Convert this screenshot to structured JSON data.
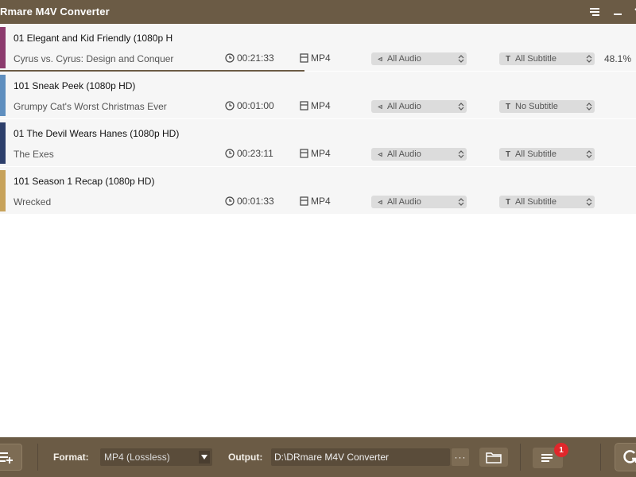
{
  "window": {
    "title": "Rmare M4V Converter"
  },
  "colors": {
    "chrome": "#6b5b45",
    "progress": "#6b5b45",
    "badge": "#e0272b"
  },
  "items": [
    {
      "title": "01 Elegant and Kid Friendly (1080p H",
      "show": "Cyrus vs. Cyrus: Design and Conquer",
      "duration": "00:21:33",
      "format": "MP4",
      "audio": "All Audio",
      "subtitle": "All Subtitle",
      "progress_text": "48.1%",
      "progress": 0.481,
      "thumb_color": "#8c3b6e"
    },
    {
      "title": "101 Sneak Peek (1080p HD)",
      "show": "Grumpy Cat's Worst Christmas Ever",
      "duration": "00:01:00",
      "format": "MP4",
      "audio": "All Audio",
      "subtitle": "No Subtitle",
      "progress_text": "",
      "progress": 0,
      "thumb_color": "#5f8fbf"
    },
    {
      "title": "01 The Devil Wears Hanes (1080p HD)",
      "show": "The Exes",
      "duration": "00:23:11",
      "format": "MP4",
      "audio": "All Audio",
      "subtitle": "All Subtitle",
      "progress_text": "",
      "progress": 0,
      "thumb_color": "#2d3f6b"
    },
    {
      "title": "101 Season 1 Recap (1080p HD)",
      "show": "Wrecked",
      "duration": "00:01:33",
      "format": "MP4",
      "audio": "All Audio",
      "subtitle": "All Subtitle",
      "progress_text": "",
      "progress": 0,
      "thumb_color": "#c7a25a"
    }
  ],
  "footer": {
    "format_label": "Format:",
    "format_value": "MP4 (Lossless)",
    "output_label": "Output:",
    "output_value": "D:\\DRmare M4V Converter",
    "more_label": "···",
    "history_badge": "1"
  },
  "icons": {
    "menu": "menu-icon",
    "minimize": "minimize-icon",
    "clock": "clock-icon",
    "file": "file-icon",
    "audio": "audio-icon",
    "subtitle": "subtitle-T-icon",
    "add": "add-files-icon",
    "folder": "folder-icon",
    "history": "history-list-icon",
    "convert": "convert-icon"
  }
}
